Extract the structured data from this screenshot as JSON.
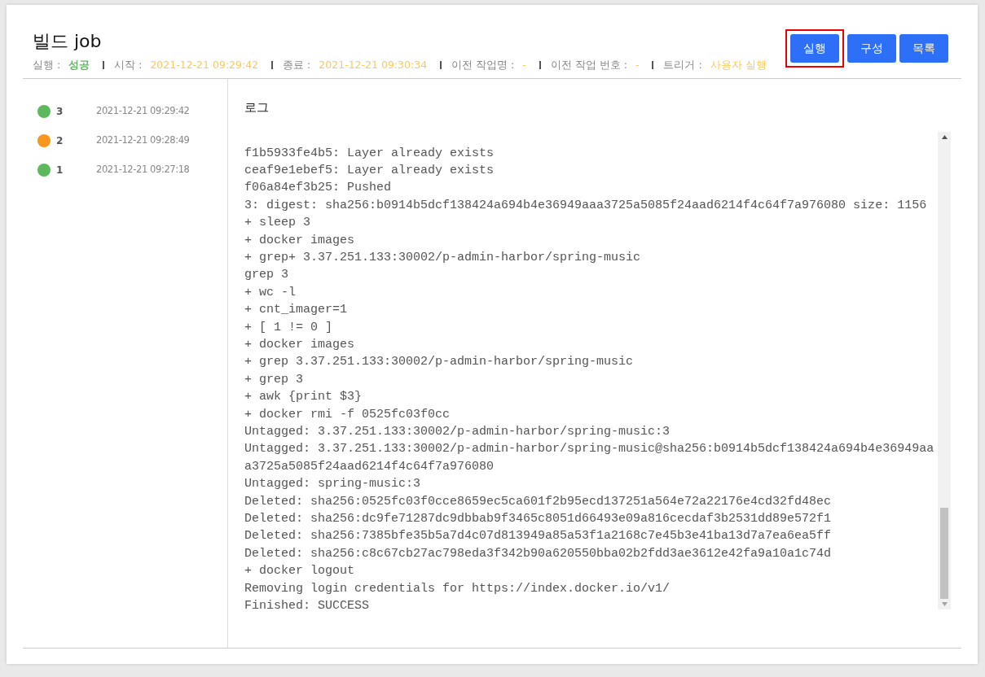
{
  "header": {
    "title": "빌드 job",
    "meta": [
      {
        "label": "실행 :",
        "value": "성공",
        "kind": "status"
      },
      {
        "label": "시작 :",
        "value": "2021-12-21 09:29:42",
        "kind": "info"
      },
      {
        "label": "종료 :",
        "value": "2021-12-21 09:30:34",
        "kind": "info"
      },
      {
        "label": "이전 작업명 :",
        "value": "-",
        "kind": "info"
      },
      {
        "label": "이전 작업 번호 :",
        "value": "-",
        "kind": "info"
      },
      {
        "label": "트리거 :",
        "value": "사용자 실행",
        "kind": "info"
      }
    ],
    "buttons": [
      {
        "label": "실행",
        "highlighted": true
      },
      {
        "label": "구성",
        "highlighted": false
      },
      {
        "label": "목록",
        "highlighted": false
      }
    ]
  },
  "builds": [
    {
      "number": "3",
      "time": "2021-12-21 09:29:42",
      "color": "#5cb85c"
    },
    {
      "number": "2",
      "time": "2021-12-21 09:28:49",
      "color": "#f7981c"
    },
    {
      "number": "1",
      "time": "2021-12-21 09:27:18",
      "color": "#5cb85c"
    }
  ],
  "log": {
    "title": "로그",
    "lines": [
      "f1b5933fe4b5: Layer already exists",
      "ceaf9e1ebef5: Layer already exists",
      "f06a84ef3b25: Pushed",
      "3: digest: sha256:b0914b5dcf138424a694b4e36949aaa3725a5085f24aad6214f4c64f7a976080 size: 1156",
      "+ sleep 3",
      "+ docker images",
      "+ grep+  3.37.251.133:30002/p-admin-harbor/spring-music",
      "grep 3",
      "+ wc -l",
      "+ cnt_imager=1",
      "+ [ 1 != 0 ]",
      "+ docker images",
      "+ grep 3.37.251.133:30002/p-admin-harbor/spring-music",
      "+ grep 3",
      "+ awk {print $3}",
      "+ docker rmi -f 0525fc03f0cc",
      "Untagged: 3.37.251.133:30002/p-admin-harbor/spring-music:3",
      "Untagged: 3.37.251.133:30002/p-admin-harbor/spring-music@sha256:b0914b5dcf138424a694b4e36949aaa3725a5085f24aad6214f4c64f7a976080",
      "Untagged: spring-music:3",
      "Deleted: sha256:0525fc03f0cce8659ec5ca601f2b95ecd137251a564e72a22176e4cd32fd48ec",
      "Deleted: sha256:dc9fe71287dc9dbbab9f3465c8051d66493e09a816cecdaf3b2531dd89e572f1",
      "Deleted: sha256:7385bfe35b5a7d4c07d813949a85a53f1a2168c7e45b3e41ba13d7a7ea6ea5ff",
      "Deleted: sha256:c8c67cb27ac798eda3f342b90a620550bba02b2fdd3ae3612e42fa9a10a1c74d",
      "+ docker logout",
      "Removing login credentials for https://index.docker.io/v1/",
      "Finished: SUCCESS"
    ]
  }
}
